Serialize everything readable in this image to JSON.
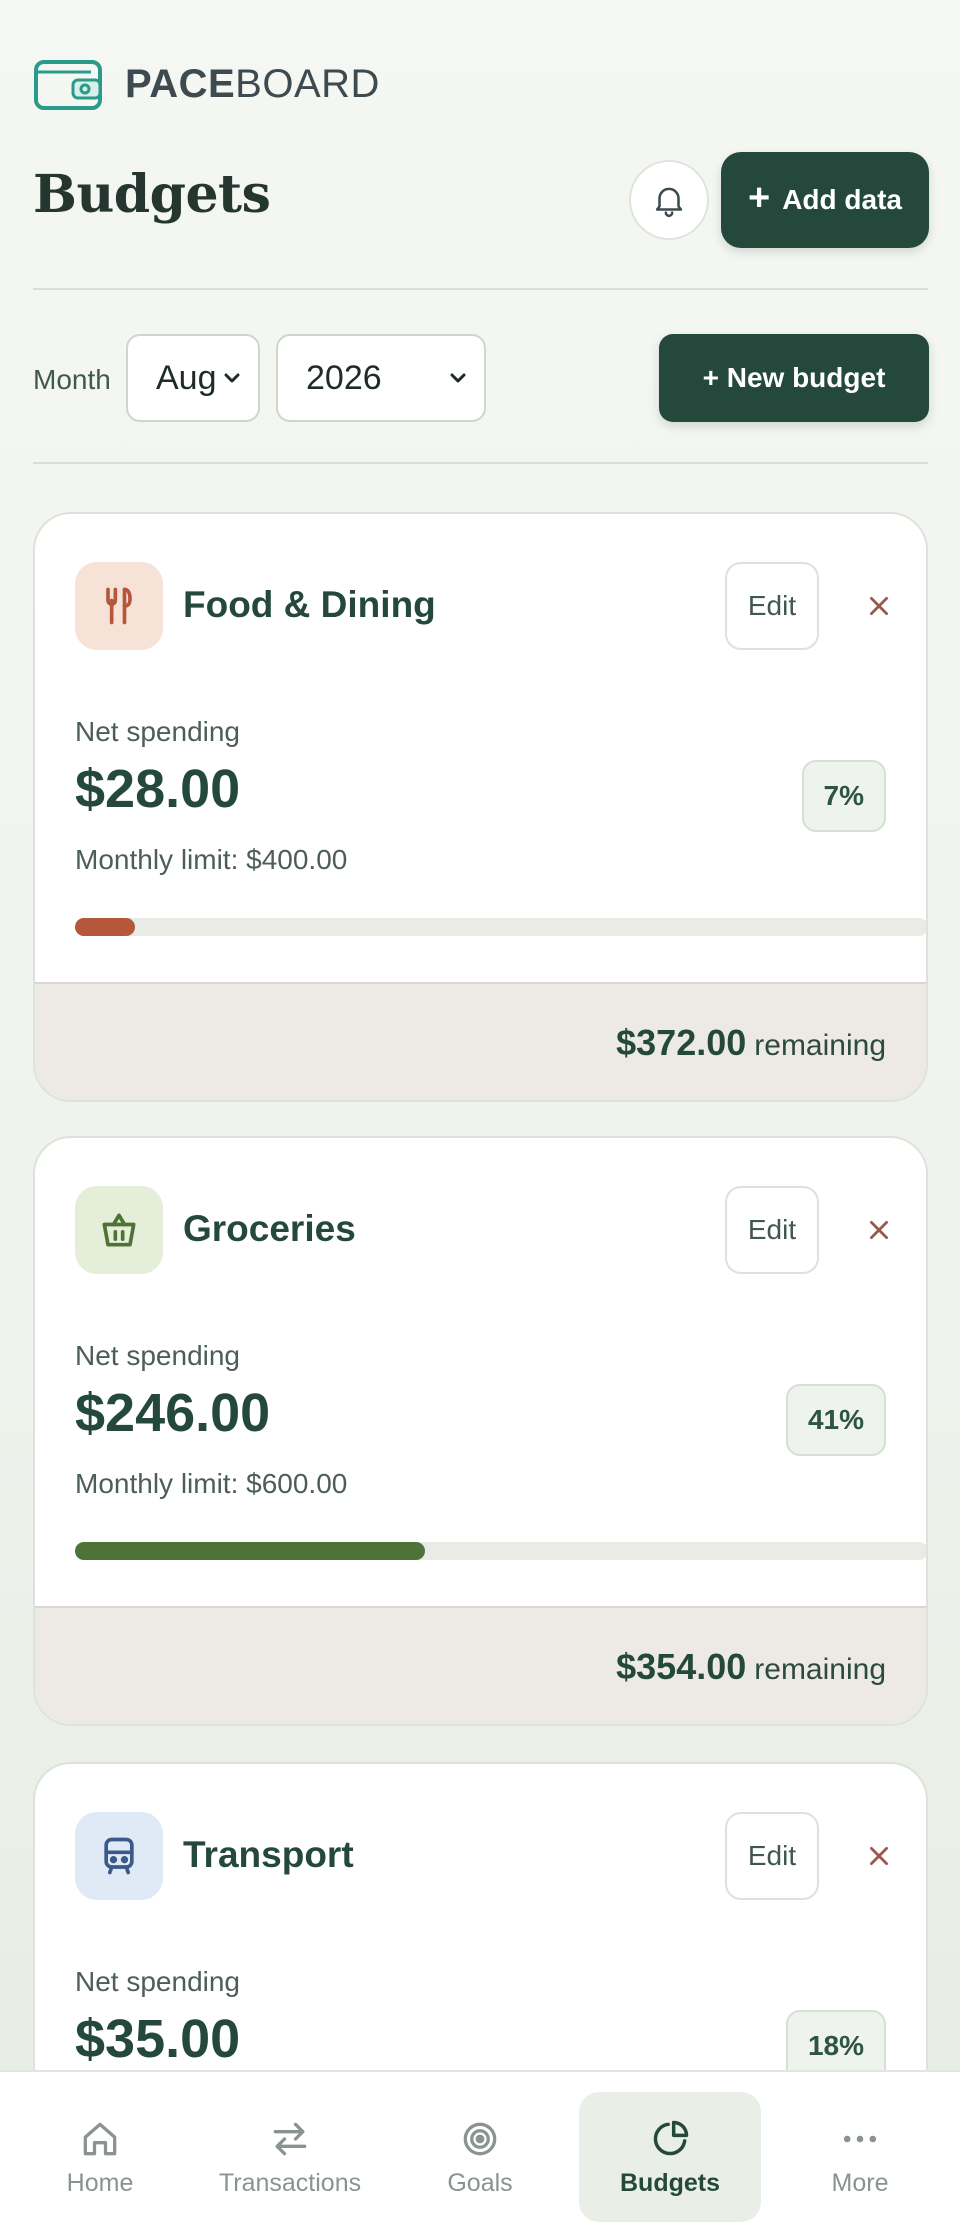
{
  "brand": {
    "name_bold": "PACE",
    "name_regular": "BOARD"
  },
  "header": {
    "title": "Budgets",
    "add_data_label": "Add data"
  },
  "filters": {
    "month_label": "Month",
    "month_value": "Aug",
    "year_value": "2026",
    "new_budget_label": "+ New budget"
  },
  "budgets": [
    {
      "name": "Food & Dining",
      "icon": "fork-knife-icon",
      "edit_label": "Edit",
      "net_label": "Net spending",
      "net_value": "$28.00",
      "percent_label": "7%",
      "percent": 7,
      "limit_text": "Monthly limit: $400.00",
      "remaining_amount": "$372.00",
      "remaining_word": "remaining",
      "color": "#b5573a",
      "icon_bg": "#f7e2d8"
    },
    {
      "name": "Groceries",
      "icon": "basket-icon",
      "edit_label": "Edit",
      "net_label": "Net spending",
      "net_value": "$246.00",
      "percent_label": "41%",
      "percent": 41,
      "limit_text": "Monthly limit: $600.00",
      "remaining_amount": "$354.00",
      "remaining_word": "remaining",
      "color": "#4e7339",
      "icon_bg": "#e5eed8"
    },
    {
      "name": "Transport",
      "icon": "bus-icon",
      "edit_label": "Edit",
      "net_label": "Net spending",
      "net_value": "$35.00",
      "percent_label": "18%",
      "percent": 18,
      "color": "#3b5a8a",
      "icon_bg": "#dfeaf6"
    }
  ],
  "nav": {
    "items": [
      {
        "label": "Home",
        "icon": "home-icon"
      },
      {
        "label": "Transactions",
        "icon": "transfer-arrows-icon"
      },
      {
        "label": "Goals",
        "icon": "target-icon"
      },
      {
        "label": "Budgets",
        "icon": "pie-chart-icon",
        "active": true
      },
      {
        "label": "More",
        "icon": "more-dots-icon"
      }
    ]
  },
  "colors": {
    "accent": "#24493c",
    "close": "#9a5a4a"
  }
}
